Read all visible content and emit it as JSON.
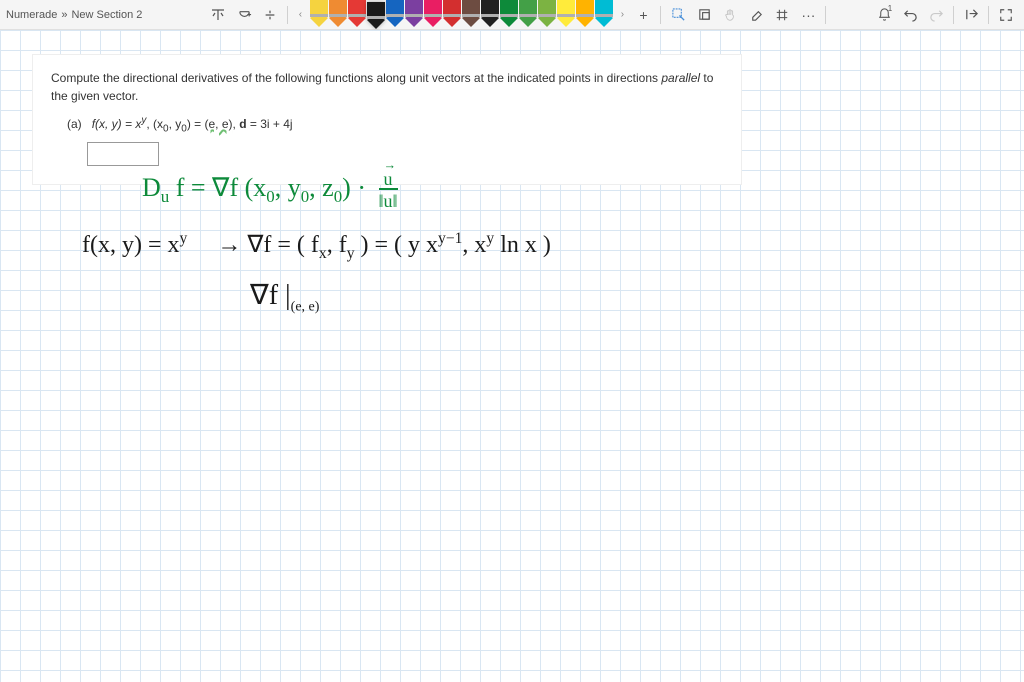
{
  "breadcrumb": {
    "site": "Numerade",
    "sep": "»",
    "section": "New Section 2"
  },
  "pens": [
    {
      "c": "#f5d33f"
    },
    {
      "c": "#ef8b32"
    },
    {
      "c": "#e53935"
    },
    {
      "c": "#1a1a1a",
      "selected": true
    },
    {
      "c": "#1565c0"
    },
    {
      "c": "#7b3fa0"
    },
    {
      "c": "#e91e63"
    },
    {
      "c": "#d32f2f"
    },
    {
      "c": "#6d4c41"
    },
    {
      "c": "#212121"
    },
    {
      "c": "#0d8a3a"
    },
    {
      "c": "#43a047"
    },
    {
      "c": "#7cb342"
    },
    {
      "c": "#ffeb3b"
    },
    {
      "c": "#ffb300"
    },
    {
      "c": "#00bcd4"
    }
  ],
  "question": {
    "main": "Compute the directional derivatives of the following functions along unit vectors at the indicated points in directions ",
    "italic": "parallel",
    "tail": " to the given vector.",
    "part_label": "(a)",
    "formula_pre": "f(x, y) = x",
    "formula_exp": "y",
    "formula_mid": ", (x",
    "sub0a": "0",
    "formula_mid2": ", y",
    "sub0b": "0",
    "formula_mid3": ") = ",
    "ee": "(e, e)",
    "formula_post": ", ",
    "d": "d",
    "formula_end": " = 3i + 4j"
  },
  "hand": {
    "line1a": "D",
    "line1a_sub": "u",
    "line1b": "f   =   ∇f (x",
    "line1b_sub": "0",
    "line1c": ", y",
    "line1c_sub": "0",
    "line1d": ", z",
    "line1d_sub": "0",
    "line1e": ")  ·",
    "line1_frac_top": "u",
    "line1_frac_bot": "‖u‖",
    "line2a": "f(x, y)  =  x",
    "line2a_sup": "y",
    "line2b": "→   ∇f =  ( f",
    "line2b_sub1": "x",
    "line2c": ",  f",
    "line2c_sub": "y",
    "line2d": " )  =  (  y x",
    "line2d_sup": "y−1",
    "line2e": ",   x",
    "line2e_sup": "y",
    "line2f": " ln x  )",
    "line3a": "∇f |",
    "line3_sub": "(e, e)"
  }
}
